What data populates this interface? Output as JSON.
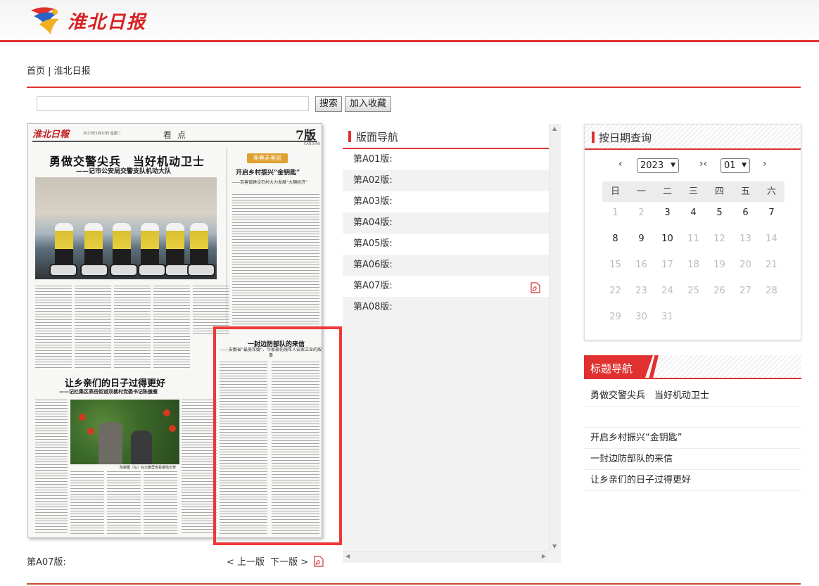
{
  "header": {
    "logo_text": "淮北日报",
    "brand_red": "#d82020",
    "accent_line": "#e03030"
  },
  "breadcrumb": {
    "home": "首页",
    "separator": " | ",
    "current": "淮北日报"
  },
  "search": {
    "input_value": "",
    "search_label": "搜索",
    "favorite_label": "加入收藏"
  },
  "newspaper": {
    "masthead": "淮北日報",
    "date_line": "2023年1月10日 星期二",
    "section": "看点",
    "section_pinyin": "KANDIAN",
    "edition": "7版",
    "headline_main": "勇做交警尖兵　当好机动卫士",
    "headline_main_sub": "——记市公安局交警支队机动大队",
    "feature_tag": "新春走基层",
    "feature_headline": "开启乡村振兴“金钥匙”",
    "feature_sub": "——百善镇建设石村大力发展“大棚经济”",
    "headline_second": "让乡亲们的日子过得更好",
    "headline_second_sub": "——记杜集区高岳街道双楼村党委书记陈傲雁",
    "photo_caption": "陈傲雁（左）在大棚里查看番茄长势",
    "headline_letter": "一封边防部队的来信",
    "headline_letter_sub": "——安徽省“最美军嫂”、华家鞍伤残军人安家立业的故事"
  },
  "pager": {
    "page_label": "第A07版:",
    "prev": "< 上一版",
    "next": "下一版 >"
  },
  "page_nav": {
    "title": "版面导航",
    "items": [
      {
        "label": "第A01版:",
        "has_pdf": false
      },
      {
        "label": "第A02版:",
        "has_pdf": false
      },
      {
        "label": "第A03版:",
        "has_pdf": false
      },
      {
        "label": "第A04版:",
        "has_pdf": false
      },
      {
        "label": "第A05版:",
        "has_pdf": false
      },
      {
        "label": "第A06版:",
        "has_pdf": false
      },
      {
        "label": "第A07版:",
        "has_pdf": true
      },
      {
        "label": "第A08版:",
        "has_pdf": false
      }
    ]
  },
  "date_query": {
    "title": "按日期查询",
    "prev_year": "‹",
    "year": "2023",
    "prev_month": "›‹",
    "month": "01",
    "next_month": "›",
    "weekdays": [
      "日",
      "一",
      "二",
      "三",
      "四",
      "五",
      "六"
    ],
    "weeks": [
      [
        {
          "d": "1",
          "on": false
        },
        {
          "d": "2",
          "on": false
        },
        {
          "d": "3",
          "on": true
        },
        {
          "d": "4",
          "on": true
        },
        {
          "d": "5",
          "on": true
        },
        {
          "d": "6",
          "on": true
        },
        {
          "d": "7",
          "on": true
        }
      ],
      [
        {
          "d": "8",
          "on": true
        },
        {
          "d": "9",
          "on": true
        },
        {
          "d": "10",
          "on": true
        },
        {
          "d": "11",
          "on": false
        },
        {
          "d": "12",
          "on": false
        },
        {
          "d": "13",
          "on": false
        },
        {
          "d": "14",
          "on": false
        }
      ],
      [
        {
          "d": "15",
          "on": false
        },
        {
          "d": "16",
          "on": false
        },
        {
          "d": "17",
          "on": false
        },
        {
          "d": "18",
          "on": false
        },
        {
          "d": "19",
          "on": false
        },
        {
          "d": "20",
          "on": false
        },
        {
          "d": "21",
          "on": false
        }
      ],
      [
        {
          "d": "22",
          "on": false
        },
        {
          "d": "23",
          "on": false
        },
        {
          "d": "24",
          "on": false
        },
        {
          "d": "25",
          "on": false
        },
        {
          "d": "26",
          "on": false
        },
        {
          "d": "27",
          "on": false
        },
        {
          "d": "28",
          "on": false
        }
      ],
      [
        {
          "d": "29",
          "on": false
        },
        {
          "d": "30",
          "on": false
        },
        {
          "d": "31",
          "on": false
        }
      ]
    ]
  },
  "title_nav": {
    "title": "标题导航",
    "items": [
      {
        "label": "勇做交警尖兵　当好机动卫士",
        "gap_after": true
      },
      {
        "label": "开启乡村振兴“金钥匙”",
        "gap_after": false
      },
      {
        "label": "一封边防部队的来信",
        "gap_after": false
      },
      {
        "label": "让乡亲们的日子过得更好",
        "gap_after": false
      }
    ]
  }
}
